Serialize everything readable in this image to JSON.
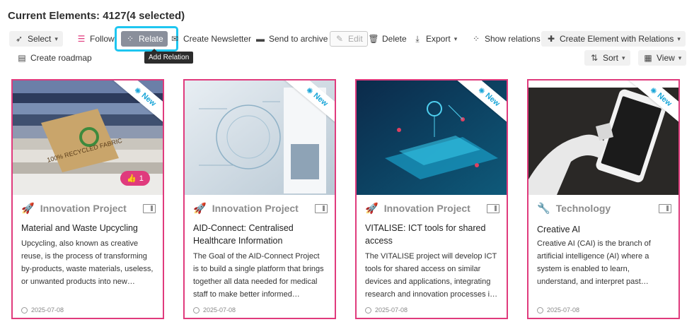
{
  "header": {
    "title": "Current Elements:  4127(4 selected)"
  },
  "toolbar": {
    "select": "Select",
    "follow": "Follow",
    "relate": "Relate",
    "tooltip": "Add Relation",
    "newsletter": "Create Newsletter",
    "archive": "Send to archive",
    "edit": "Edit",
    "delete": "Delete",
    "export": "Export",
    "show_relations": "Show relations",
    "create_with_relations": "Create Element with Relations",
    "roadmap": "Create roadmap",
    "sort": "Sort",
    "view": "View"
  },
  "colors": {
    "accent": "#e03b7d",
    "highlight": "#1ec6f0",
    "new_badge": "#1aa6d8"
  },
  "cards": [
    {
      "badge": "New",
      "likes": "1",
      "category": "Innovation Project",
      "category_icon": "rocket-icon",
      "title": "Material and Waste Upcycling",
      "description": "Upcycling, also known as creative reuse, is the process of transforming by-products, waste materials, useless, or unwanted products into new…",
      "date": "2025-07-08",
      "tag_text": "100% RECYCLED FABRIC"
    },
    {
      "badge": "New",
      "category": "Innovation Project",
      "category_icon": "rocket-icon",
      "title": "AID-Connect: Centralised Healthcare Information",
      "description": "The Goal of the AID-Connect Project is to build a single platform that brings together all data needed for medical staff to make better informed…",
      "date": "2025-07-08"
    },
    {
      "badge": "New",
      "category": "Innovation Project",
      "category_icon": "rocket-icon",
      "title": "VITALISE: ICT tools for shared access",
      "description": "The VITALISE project will develop ICT tools for shared access on similar devices and applications, integrating research and innovation processes i…",
      "date": "2025-07-08"
    },
    {
      "badge": "New",
      "category": "Technology",
      "category_icon": "wrench-icon",
      "title": "Creative AI",
      "description": "Creative AI (CAI) is the branch of artificial intelligence (AI) where a system is enabled to learn, understand, and interpret past…",
      "date": "2025-07-08"
    }
  ]
}
